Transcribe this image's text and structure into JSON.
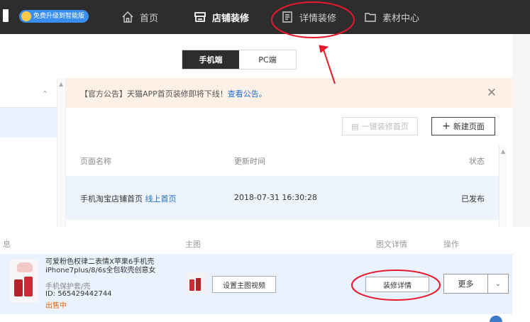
{
  "topnav": {
    "upgrade_badge": "免费升级到智能版",
    "items": [
      {
        "label": "首页",
        "icon": "home-icon"
      },
      {
        "label": "店铺装修",
        "icon": "store-icon",
        "active": true
      },
      {
        "label": "详情装修",
        "icon": "document-icon"
      },
      {
        "label": "素材中心",
        "icon": "folder-icon"
      }
    ]
  },
  "device_switch": {
    "options": [
      "手机端",
      "PC端"
    ],
    "selected": "手机端"
  },
  "notice": {
    "text": "【官方公告】天猫APP首页装修即将下线！",
    "link": "查看公告。"
  },
  "page_actions": {
    "one_click": "一键装修首页",
    "new_page": "新建页面"
  },
  "pages_table": {
    "columns": [
      "页面名称",
      "更新时间",
      "状态"
    ],
    "rows": [
      {
        "name": "手机淘宝店铺首页",
        "tag": "线上首页",
        "updated": "2018-07-31 16:30:28",
        "status": "已发布"
      }
    ]
  },
  "product_table": {
    "columns": [
      "息",
      "主图",
      "图文详情",
      "操作"
    ],
    "rows": [
      {
        "title": "可爱粉色权律二表情X苹果6手机壳iPhone7plus/8/6s全包软壳创意女",
        "category": "手机保护套/壳",
        "id": "ID: 565429442744",
        "status": "出售中",
        "video_button": "设置主图视频",
        "detail_button": "装修详情",
        "more_button": "更多"
      }
    ]
  },
  "colors": {
    "nav_bg": "#2d2d2d",
    "accent_blue": "#1a6fd1",
    "notice_bg": "#fdf0e7",
    "status_orange": "#e5640d",
    "annotation_red": "#e8192c"
  }
}
